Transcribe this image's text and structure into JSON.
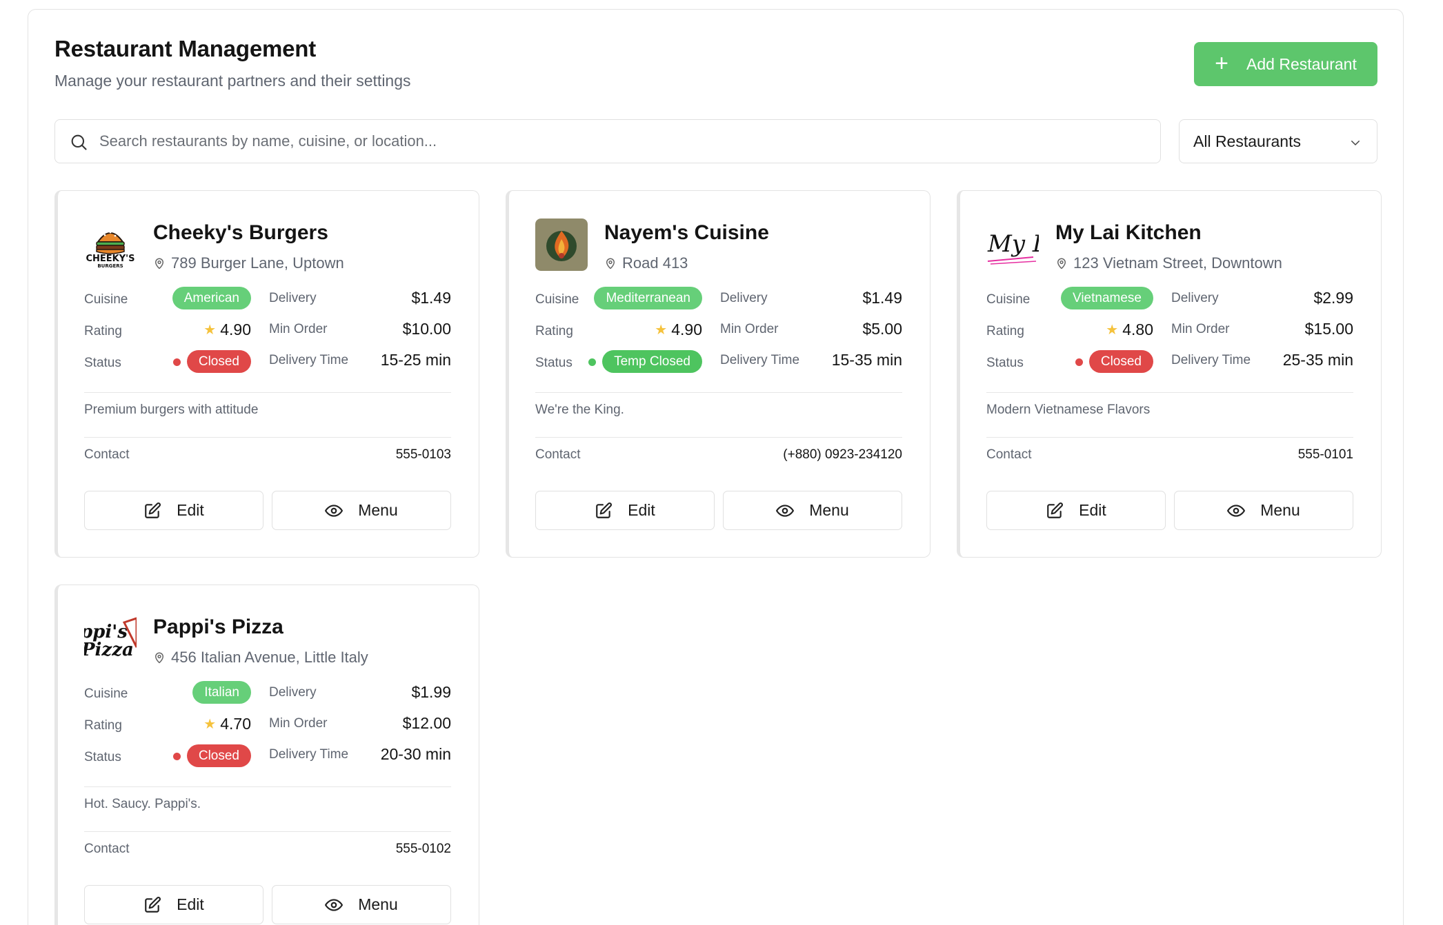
{
  "header": {
    "title": "Restaurant Management",
    "subtitle": "Manage your restaurant partners and their settings",
    "add_button_label": "Add Restaurant"
  },
  "search": {
    "placeholder": "Search restaurants by name, cuisine, or location...",
    "value": ""
  },
  "filter": {
    "selected": "All Restaurants"
  },
  "labels": {
    "cuisine": "Cuisine",
    "rating": "Rating",
    "status": "Status",
    "delivery": "Delivery",
    "min_order": "Min Order",
    "delivery_time": "Delivery Time",
    "contact": "Contact",
    "edit": "Edit",
    "menu": "Menu"
  },
  "colors": {
    "accent": "#5dc66c",
    "cuisine_pill": "#66cf79",
    "closed": "#e04848",
    "temp_closed": "#4ec45f",
    "star": "#f5c23c"
  },
  "restaurants": [
    {
      "name": "Cheeky's Burgers",
      "address": "789 Burger Lane, Uptown",
      "cuisine": "American",
      "rating": "4.90",
      "status": "Closed",
      "delivery": "$1.49",
      "min_order": "$10.00",
      "delivery_time": "15-25 min",
      "description": "Premium burgers with attitude",
      "contact": "555-0103",
      "logo": "burger-logo",
      "logo_text": "CHEEKY'S"
    },
    {
      "name": "Nayem's Cuisine",
      "address": "Road 413",
      "cuisine": "Mediterranean",
      "rating": "4.90",
      "status": "Temp Closed",
      "delivery": "$1.49",
      "min_order": "$5.00",
      "delivery_time": "15-35 min",
      "description": "We're the King.",
      "contact": "(+880) 0923-234120",
      "logo": "flame-logo"
    },
    {
      "name": "My Lai Kitchen",
      "address": "123 Vietnam Street, Downtown",
      "cuisine": "Vietnamese",
      "rating": "4.80",
      "status": "Closed",
      "delivery": "$2.99",
      "min_order": "$15.00",
      "delivery_time": "25-35 min",
      "description": "Modern Vietnamese Flavors",
      "contact": "555-0101",
      "logo": "script-logo"
    },
    {
      "name": "Pappi's Pizza",
      "address": "456 Italian Avenue, Little Italy",
      "cuisine": "Italian",
      "rating": "4.70",
      "status": "Closed",
      "delivery": "$1.99",
      "min_order": "$12.00",
      "delivery_time": "20-30 min",
      "description": "Hot. Saucy. Pappi's.",
      "contact": "555-0102",
      "logo": "pizza-logo"
    }
  ]
}
